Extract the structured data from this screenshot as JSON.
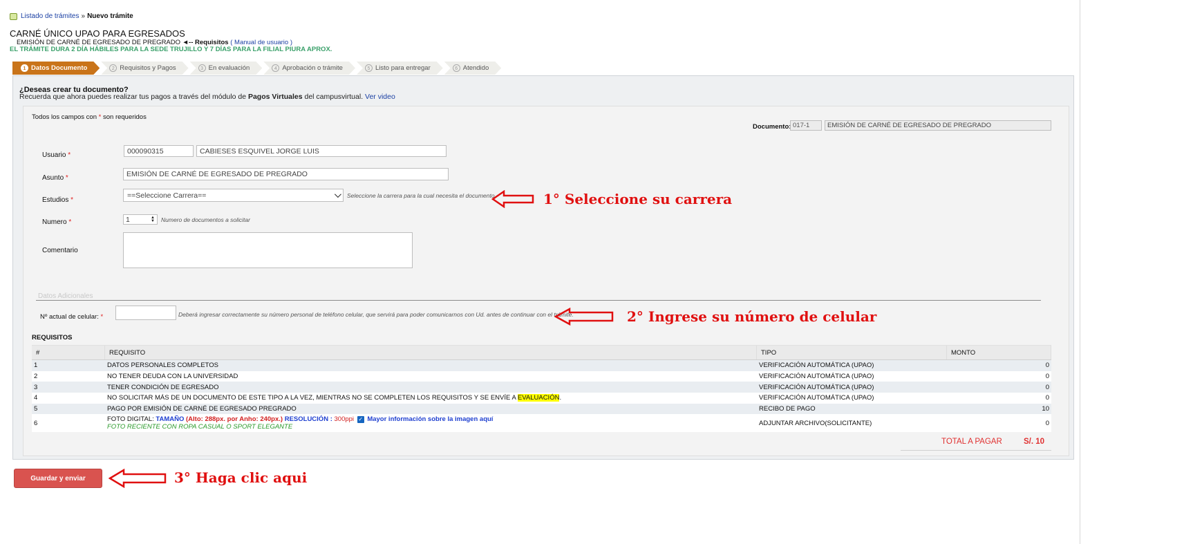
{
  "breadcrumb": {
    "link": "Listado de trámites",
    "sep": "»",
    "current": "Nuevo trámite"
  },
  "header": {
    "title": "CARNÉ ÚNICO UPAO PARA EGRESADOS",
    "subtitle": "EMISIÓN DE CARNÉ DE EGRESADO DE PREGRADO",
    "req_arrow": "◄-- Requisitos",
    "manual_link": "( Manual de usuario )",
    "duration": "EL TRÁMITE DURA 2 DÍA HÁBILES PARA LA SEDE TRUJILLO Y 7 DÍAS PARA LA FILIAL PIURA APROX."
  },
  "steps": [
    {
      "num": "1",
      "label": "Datos Documento",
      "active": true
    },
    {
      "num": "2",
      "label": "Requisitos y Pagos"
    },
    {
      "num": "3",
      "label": "En evaluación"
    },
    {
      "num": "4",
      "label": "Aprobación o trámite"
    },
    {
      "num": "5",
      "label": "Listo para entregar"
    },
    {
      "num": "6",
      "label": "Atendido"
    }
  ],
  "intro": {
    "question": "¿Deseas crear tu documento?",
    "text_a": "Recuerda que ahora puedes realizar tus pagos a través del módulo de",
    "text_bold": "Pagos Virtuales",
    "text_b": "del campusvirtual.",
    "video_link": "Ver video"
  },
  "form": {
    "required_a": "Todos los campos con",
    "required_star": "*",
    "required_b": "son requeridos",
    "doc_label": "Documento:",
    "doc_code": "017-1",
    "doc_name": "EMISIÓN DE CARNÉ DE EGRESADO DE PREGRADO",
    "usuario_label": "Usuario",
    "usuario_code": "000090315",
    "usuario_name": "CABIESES  ESQUIVEL JORGE LUIS",
    "asunto_label": "Asunto",
    "asunto_value": "EMISIÓN DE CARNÉ DE EGRESADO DE PREGRADO",
    "estudios_label": "Estudios",
    "estudios_selected": "==Seleccione Carrera==",
    "estudios_hint": "Seleccione la carrera para la cual necesita el documento",
    "numero_label": "Numero",
    "numero_value": "1",
    "numero_hint": "Numero de documentos a solicitar",
    "comentario_label": "Comentario",
    "comentario_value": "",
    "datos_adicionales": "Datos Adicionales",
    "celular_label": "Nº actual de celular:",
    "celular_value": "",
    "celular_hint": "Deberá ingresar correctamente su número personal de teléfono celular, que servirá para poder comunicarnos con Ud. antes de continuar con el trámite."
  },
  "requisitos": {
    "title": "REQUISITOS",
    "headers": [
      "#",
      "REQUISITO",
      "TIPO",
      "MONTO"
    ],
    "rows": [
      {
        "n": "1",
        "req": "DATOS PERSONALES COMPLETOS",
        "tipo": "VERIFICACIÓN AUTOMÁTICA (UPAO)",
        "monto": "0"
      },
      {
        "n": "2",
        "req": "NO TENER DEUDA CON LA UNIVERSIDAD",
        "tipo": "VERIFICACIÓN AUTOMÁTICA (UPAO)",
        "monto": "0"
      },
      {
        "n": "3",
        "req": "TENER CONDICIÓN DE EGRESADO",
        "tipo": "VERIFICACIÓN AUTOMÁTICA (UPAO)",
        "monto": "0"
      },
      {
        "n": "4",
        "req": "NO SOLICITAR MÁS DE UN DOCUMENTO DE ESTE TIPO A LA VEZ,  MIENTRAS NO SE COMPLETEN LOS REQUISITOS Y SE ENVÍE A",
        "req_hl": "EVALUACIÓN",
        "req_end": ".",
        "tipo": "VERIFICACIÓN AUTOMÁTICA (UPAO)",
        "monto": "0"
      },
      {
        "n": "5",
        "req": "PAGO POR EMISIÓN DE CARNÉ DE EGRESADO PREGRADO",
        "tipo": "RECIBO DE PAGO",
        "monto": "10"
      },
      {
        "n": "6",
        "foto_a": "FOTO DIGITAL:",
        "foto_tam": "TAMAÑO",
        "foto_dims": "(Alto: 288px. por Anho: 240px.)",
        "foto_res": "RESOLUCIÓN :",
        "foto_ppi": "300ppi",
        "foto_more": "Mayor información sobre la imagen aquí",
        "foto_note": "FOTO RECIENTE CON ROPA CASUAL O SPORT ELEGANTE",
        "tipo": "ADJUNTAR ARCHIVO(SOLICITANTE)",
        "monto": "0"
      }
    ],
    "total_label": "TOTAL A PAGAR",
    "total_value": "S/. 10"
  },
  "submit_label": "Guardar y enviar",
  "annotations": {
    "a1": "1° Seleccione su carrera",
    "a2": "2° Ingrese su número de celular",
    "a3": "3° Haga clic aqui"
  },
  "colors": {
    "accent_step": "#c9741a",
    "button": "#d9534f",
    "annotation": "#e01010",
    "link": "#1a3fa3"
  }
}
